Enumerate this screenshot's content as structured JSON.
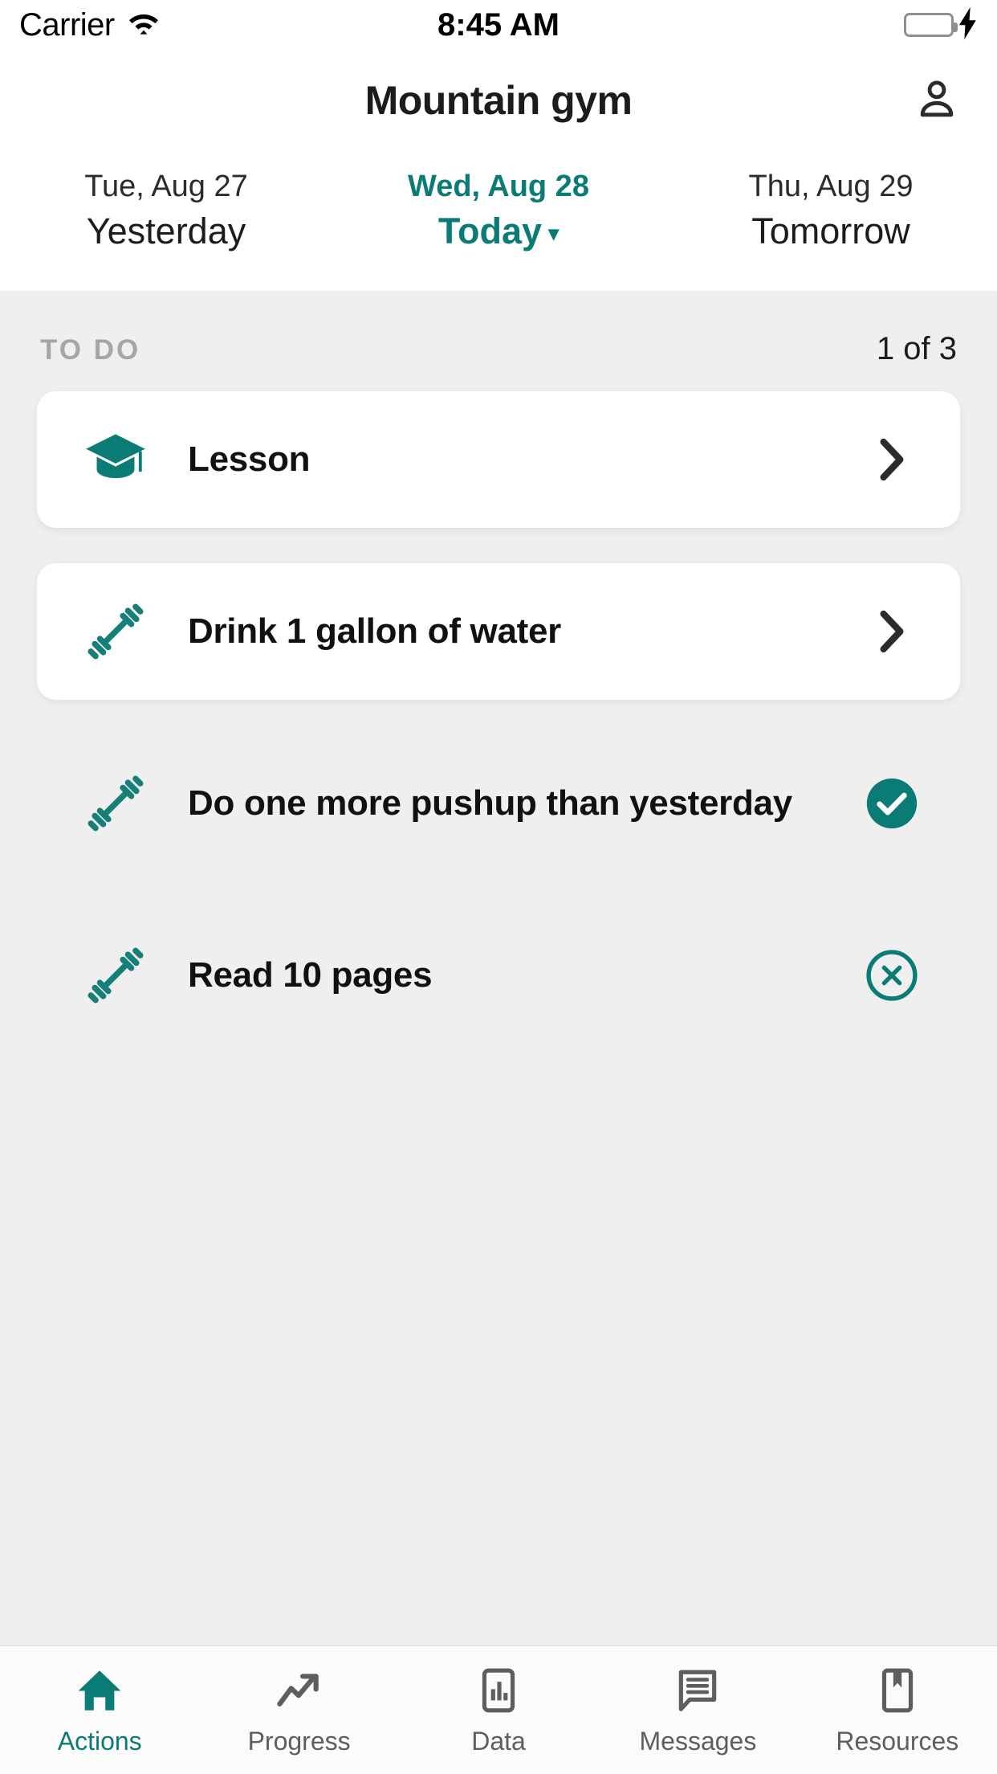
{
  "statusbar": {
    "carrier": "Carrier",
    "wifi_icon": "wifi-icon",
    "time": "8:45 AM",
    "battery_icon": "battery-icon",
    "charging_icon": "lightning-bolt-icon",
    "battery_color": "#4cd964"
  },
  "header": {
    "title": "Mountain gym",
    "profile_icon": "person-icon"
  },
  "theme": {
    "accent": "#0b7b76",
    "bg": "#efefef",
    "card": "#ffffff"
  },
  "date_selector": {
    "days": [
      {
        "date": "Tue, Aug 27",
        "label": "Yesterday",
        "active": false
      },
      {
        "date": "Wed, Aug 28",
        "label": "Today",
        "active": true,
        "caret": "▾"
      },
      {
        "date": "Thu, Aug 29",
        "label": "Tomorrow",
        "active": false
      }
    ]
  },
  "todo": {
    "section_title": "TO DO",
    "count": "1 of 3",
    "items": [
      {
        "label": "Lesson",
        "icon": "graduation-cap-icon",
        "action": "chevron-right-icon",
        "state": "pending"
      },
      {
        "label": "Drink 1 gallon of water",
        "icon": "dumbbell-icon",
        "action": "chevron-right-icon",
        "state": "pending"
      },
      {
        "label": "Do one more pushup than yesterday",
        "icon": "dumbbell-icon",
        "action": "check-circle-icon",
        "state": "done"
      },
      {
        "label": "Read 10 pages",
        "icon": "dumbbell-icon",
        "action": "x-circle-icon",
        "state": "done"
      }
    ]
  },
  "tabbar": {
    "tabs": [
      {
        "label": "Actions",
        "icon": "home-icon",
        "active": true
      },
      {
        "label": "Progress",
        "icon": "trending-up-icon",
        "active": false
      },
      {
        "label": "Data",
        "icon": "bar-chart-icon",
        "active": false
      },
      {
        "label": "Messages",
        "icon": "chat-bubble-icon",
        "active": false
      },
      {
        "label": "Resources",
        "icon": "bookmark-icon",
        "active": false
      }
    ]
  }
}
